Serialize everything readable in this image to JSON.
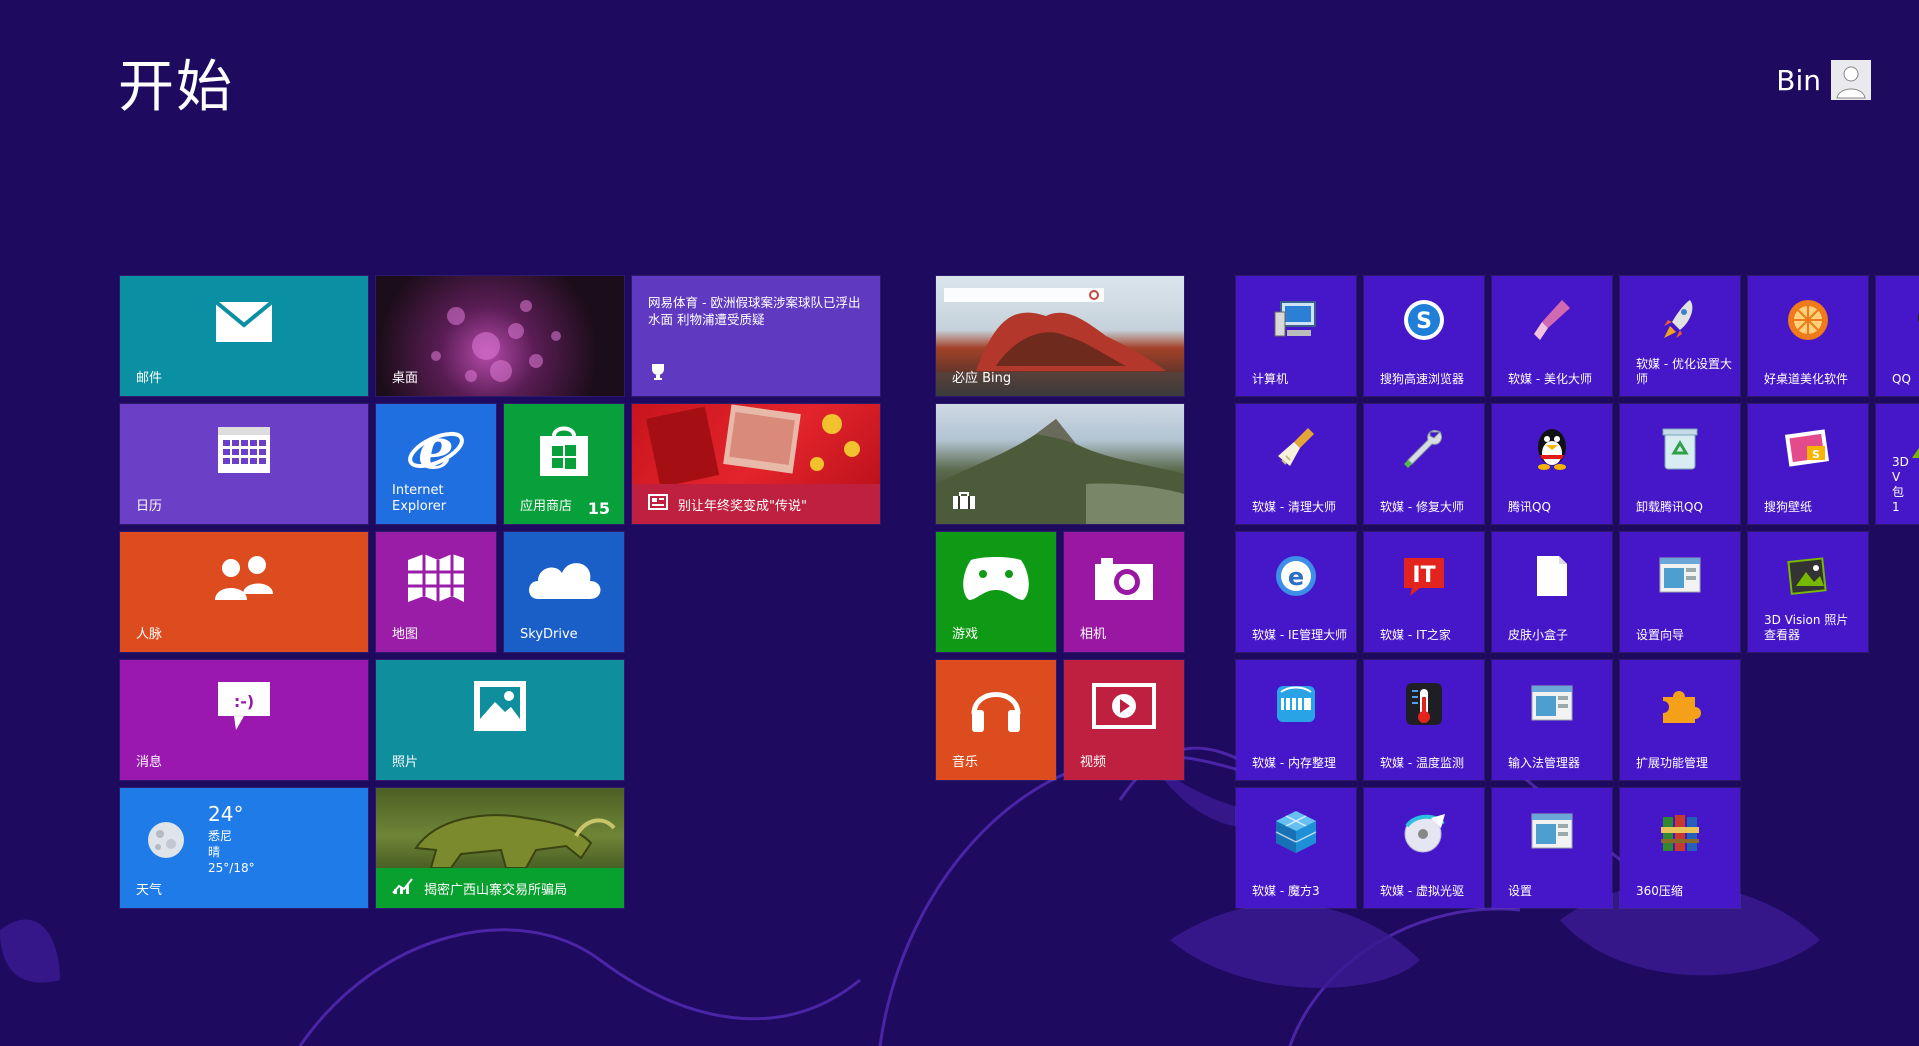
{
  "start": {
    "title": "开始"
  },
  "user": {
    "name": "Bin"
  },
  "tiles": {
    "mail": {
      "label": "邮件",
      "color": "#0a8fa3"
    },
    "desktop": {
      "label": "桌面"
    },
    "news": {
      "text": "网易体育 - 欧洲假球案涉案球队已浮出水面 利物浦遭受质疑",
      "color": "#5f3ac0"
    },
    "bing": {
      "label": "必应 Bing"
    },
    "calendar": {
      "label": "日历",
      "color": "#6b3fc6"
    },
    "ie": {
      "label": "Internet Explorer",
      "color": "#1f6fe0"
    },
    "store": {
      "label": "应用商店",
      "badge": "15",
      "color": "#07a03a"
    },
    "news2": {
      "text": "别让年终奖变成\"传说\"",
      "color": "#c0203f"
    },
    "people": {
      "label": "人脉",
      "color": "#dd4c1e"
    },
    "maps": {
      "label": "地图",
      "color": "#9a1da8"
    },
    "skydrive": {
      "label": "SkyDrive",
      "color": "#1a5fc8"
    },
    "games": {
      "label": "游戏",
      "color": "#0e9a14"
    },
    "camera": {
      "label": "相机",
      "color": "#9a17a4"
    },
    "messaging": {
      "label": "消息",
      "color": "#9a18b0"
    },
    "photos": {
      "label": "照片",
      "color": "#0f8e9e"
    },
    "music": {
      "label": "音乐",
      "color": "#dd4c1e"
    },
    "video": {
      "label": "视频",
      "color": "#c0203f"
    },
    "weather": {
      "label": "天气",
      "temp": "24°",
      "city": "悉尼",
      "cond": "晴",
      "range": "25°/18°",
      "color": "#1f7be8"
    },
    "finance": {
      "text": "揭密广西山寨交易所骗局",
      "color": "#08a02e"
    }
  },
  "apps": [
    {
      "label": "计算机",
      "icon": "computer-icon"
    },
    {
      "label": "搜狗高速浏览器",
      "icon": "sogou-browser-icon"
    },
    {
      "label": "软媒 - 美化大师",
      "icon": "brush-icon"
    },
    {
      "label": "软媒 - 优化设置大师",
      "icon": "rocket-icon"
    },
    {
      "label": "好桌道美化软件",
      "icon": "orange-icon"
    },
    {
      "label": "QQ",
      "icon": "qq-app-icon"
    },
    {
      "label": "软媒 - 清理大师",
      "icon": "broom-icon"
    },
    {
      "label": "软媒 - 修复大师",
      "icon": "wrench-icon"
    },
    {
      "label": "腾讯QQ",
      "icon": "penguin-icon"
    },
    {
      "label": "卸载腾讯QQ",
      "icon": "recycle-bin-icon"
    },
    {
      "label": "搜狗壁纸",
      "icon": "wallpaper-icon"
    },
    {
      "label": "3D V 包 1",
      "icon": "3d-vision-icon"
    },
    {
      "label": "软媒 - IE管理大师",
      "icon": "ie-manager-icon"
    },
    {
      "label": "软媒 - IT之家",
      "icon": "it-home-icon"
    },
    {
      "label": "皮肤小盒子",
      "icon": "document-icon"
    },
    {
      "label": "设置向导",
      "icon": "window-icon"
    },
    {
      "label": "3D Vision 照片查看器",
      "icon": "3d-photo-viewer-icon"
    },
    {
      "label": "软媒 - 内存整理",
      "icon": "memory-icon"
    },
    {
      "label": "软媒 - 温度监测",
      "icon": "thermometer-icon"
    },
    {
      "label": "输入法管理器",
      "icon": "window-icon"
    },
    {
      "label": "扩展功能管理",
      "icon": "puzzle-icon"
    },
    {
      "label": "软媒 - 魔方3",
      "icon": "cube-icon"
    },
    {
      "label": "软媒 - 虚拟光驱",
      "icon": "disc-icon"
    },
    {
      "label": "设置",
      "icon": "window-icon"
    },
    {
      "label": "360压缩",
      "icon": "archive-icon"
    }
  ],
  "colors": {
    "background": "#1e0a5e",
    "app_tile": "#4617c8"
  }
}
